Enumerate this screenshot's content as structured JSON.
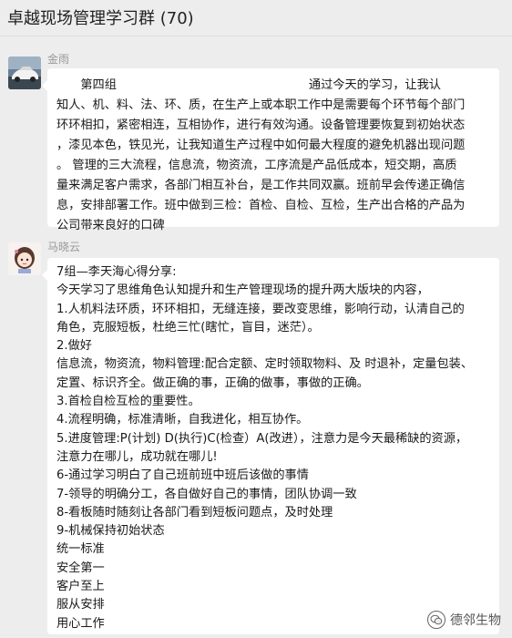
{
  "window": {
    "title": "卓越现场管理学习群 (70)"
  },
  "messages": [
    {
      "sender": "金雨",
      "avatar": "car-photo",
      "lines": [
        "　　第四组　　　　　　　　　　　　　　　　通过今天的学习，让我认",
        "知人、机、料、法、环、质，在生产上或本职工作中是需要每个环节每个部门",
        "环环相扣，紧密相连，互相协作，进行有效沟通。设备管理要恢复到初始状态",
        "，漆见本色，铁见光，让我知道生产过程中如何最大程度的避免机器出现问题",
        "。 管理的三大流程，信息流，物资流，工序流是产品低成本，短交期，高质",
        "量来满足客户需求，各部门相互补台，是工作共同双赢。班前早会传递正确信",
        "息，安排部署工作。班中做到三检：首检、自检、互检，生产出合格的产品为",
        "公司带来良好的口碑"
      ]
    },
    {
      "sender": "马晓云",
      "avatar": "cartoon-girl",
      "lines": [
        "7组—李天海心得分享:",
        "今天学习了思维角色认知提升和生产管理现场的提升两大版块的内容，",
        "1.人机料法环质，环环相扣，无缝连接，要改变思维，影响行动，认清自己的",
        "角色，克服短板，杜绝三忙(瞎忙，盲目，迷茫）。",
        "2.做好",
        "信息流，物资流，物料管理:配合定额、定时领取物料、及 时退补，定量包装、",
        "定置、标识齐全。做正确的事，正确的做事，事做的正确。",
        "3.首检自检互检的重要性。",
        "4.流程明确，标准清晰，自我进化，相互协作。",
        "5.进度管理:P(计划) D(执行)C(检查）A(改进），注意力是今天最稀缺的资源，",
        "注意力在哪儿，成功就在哪儿!",
        "6-通过学习明白了自己班前班中班后该做的事情",
        "7-领导的明确分工，各自做好自己的事情，团队协调一致",
        "8-看板随时随刻让各部门看到短板问题点，及时处理",
        "9-机械保持初始状态",
        "统一标准",
        "安全第一",
        "客户至上",
        "服从安排",
        "用心工作"
      ]
    }
  ],
  "watermark": {
    "text": "德邻生物",
    "icon": "wechat-icon"
  },
  "colors": {
    "background": "#ededed",
    "bubble": "#ffffff",
    "sender": "#999999"
  }
}
